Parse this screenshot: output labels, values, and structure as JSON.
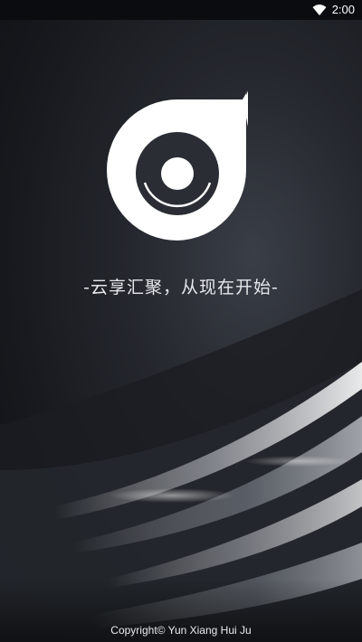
{
  "status_bar": {
    "time": "2:00",
    "wifi_icon": "wifi-icon"
  },
  "splash": {
    "logo_icon": "yunxiang-logo-icon",
    "tagline": "-云享汇聚，从现在开始-",
    "copyright": "Copyright© Yun Xiang Hui Ju"
  },
  "colors": {
    "background_dark": "#16181d",
    "text_light": "#e6e8ec",
    "logo_white": "#ffffff",
    "logo_dark": "#2a2d33"
  }
}
